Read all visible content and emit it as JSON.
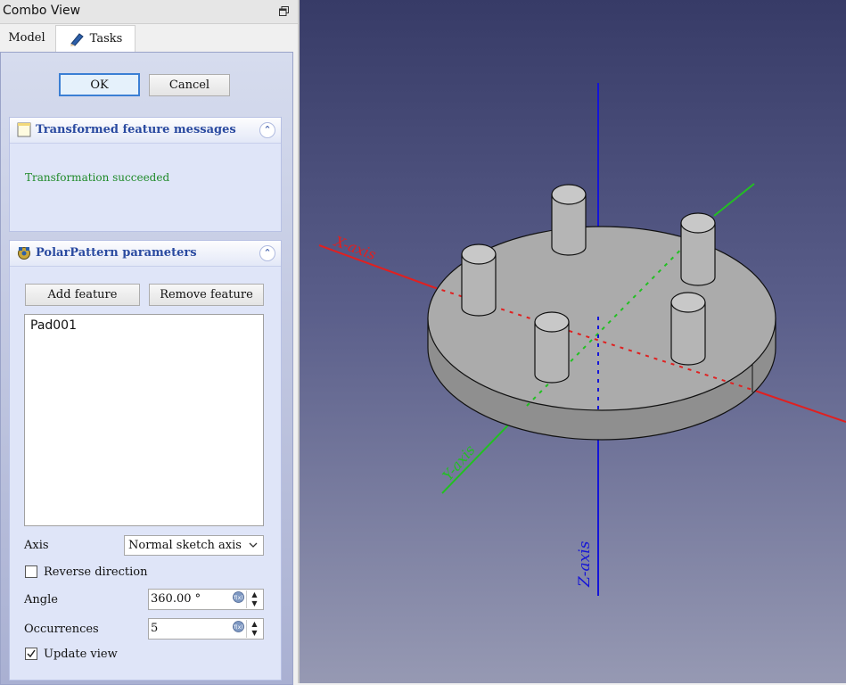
{
  "combo": {
    "title": "Combo View",
    "tabs": {
      "model": "Model",
      "tasks": "Tasks"
    }
  },
  "dialog": {
    "ok": "OK",
    "cancel": "Cancel"
  },
  "messages_box": {
    "title": "Transformed feature messages",
    "message": "Transformation succeeded",
    "message_color": "#1f8a2a"
  },
  "params_box": {
    "title": "PolarPattern parameters",
    "add_feature": "Add feature",
    "remove_feature": "Remove feature",
    "features": [
      "Pad001"
    ],
    "axis_label": "Axis",
    "axis_value": "Normal sketch axis",
    "reverse_label": "Reverse direction",
    "reverse_checked": false,
    "angle_label": "Angle",
    "angle_value": "360.00 °",
    "occurrences_label": "Occurrences",
    "occurrences_value": "5",
    "update_label": "Update view",
    "update_checked": true
  },
  "viewport": {
    "x_axis_label": "X-axis",
    "y_axis_label": "Y-axis",
    "z_axis_label": "Z-axis",
    "x_axis_color": "#e02020",
    "y_axis_color": "#22c022",
    "z_axis_color": "#1414d8"
  }
}
